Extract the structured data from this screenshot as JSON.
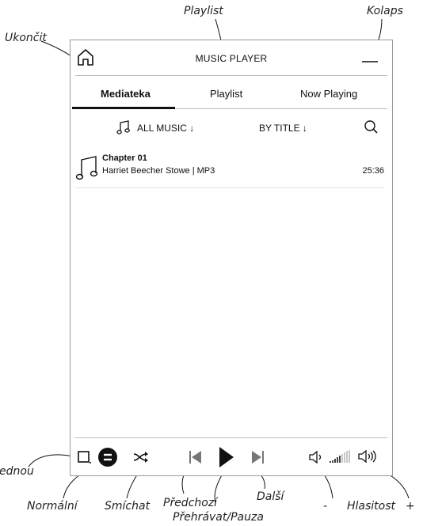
{
  "callouts": {
    "playlist": "Playlist",
    "kolaps": "Kolaps",
    "ukoncit": "Ukončit",
    "ednou": "ednou",
    "normalni": "Normální",
    "smichat": "Smíchat",
    "predchozi": "Předchozí",
    "prehravat": "Přehrávat/Pauza",
    "dalsi": "Další",
    "minus": "-",
    "hlasitost": "Hlasitost",
    "plus": "+"
  },
  "header": {
    "title": "MUSIC PLAYER"
  },
  "tabs": [
    {
      "label": "Mediateka",
      "active": true
    },
    {
      "label": "Playlist",
      "active": false
    },
    {
      "label": "Now Playing",
      "active": false
    }
  ],
  "filters": {
    "source": "ALL MUSIC ↓",
    "sort": "BY TITLE ↓"
  },
  "tracks": [
    {
      "title": "Chapter 01",
      "meta": "Harriet Beecher Stowe | MP3",
      "duration": "25:36"
    }
  ],
  "colors": {
    "accent": "#111111",
    "divider": "#bbbbbb"
  }
}
